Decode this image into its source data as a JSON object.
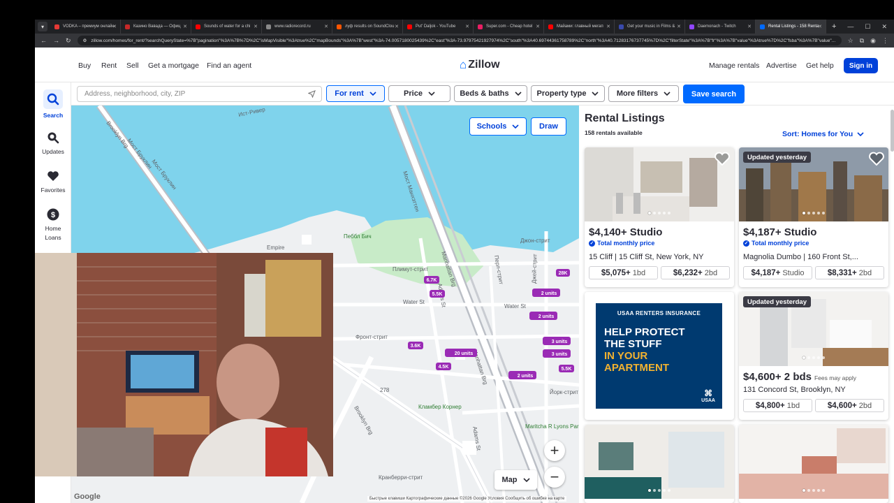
{
  "browser": {
    "tabs": [
      {
        "label": "VODKA – премиум онлайн",
        "color": "#e53935"
      },
      {
        "label": "Казино Вавада — Офиц",
        "color": "#c62828"
      },
      {
        "label": "Sounds of water for a chi",
        "color": "#ff0000"
      },
      {
        "label": "www.radiorecord.ru",
        "color": "#888888"
      },
      {
        "label": "луф results on SoundClou",
        "color": "#ff5500"
      },
      {
        "label": "Put' Daljok - YouTube",
        "color": "#ff0000"
      },
      {
        "label": "Super.com - Cheap hotel",
        "color": "#e91e63"
      },
      {
        "label": "Майами: главный мегап",
        "color": "#ff0000"
      },
      {
        "label": "Get your music in Films &",
        "color": "#3949ab"
      },
      {
        "label": "Daemonach - Twitch",
        "color": "#9146ff"
      },
      {
        "label": "Rental Listings - 158 Renta",
        "color": "#006aff"
      }
    ],
    "url": "zillow.com/homes/for_rent/?searchQueryState=%7B\"pagination\"%3A%7B%7D%2C\"isMapVisible\"%3Atrue%2C\"mapBounds\"%3A%7B\"west\"%3A-74.0057180025439%2C\"east\"%3A-73.97975421927974%2C\"south\"%3A40.69744361758789%2C\"north\"%3A40.71283176737745%7D%2C\"filterState\"%3A%7B\"fr\"%3A%7B\"value\"%3Atrue%7D%2C\"fsba\"%3A%7B\"value\"..."
  },
  "nav": {
    "left": [
      "Buy",
      "Rent",
      "Sell",
      "Get a mortgage",
      "Find an agent"
    ],
    "logo": "Zillow",
    "right": [
      "Manage rentals",
      "Advertise",
      "Get help"
    ],
    "signin": "Sign in"
  },
  "sidebar": {
    "search": "Search",
    "updates": "Updates",
    "favorites": "Favorites",
    "home": "Home",
    "loans": "Loans"
  },
  "search": {
    "placeholder": "Address, neighborhood, city, ZIP",
    "for_rent": "For rent",
    "price": "Price",
    "beds_baths": "Beds & baths",
    "property_type": "Property type",
    "more_filters": "More filters",
    "save": "Save search"
  },
  "map": {
    "schools": "Schools",
    "draw": "Draw",
    "map_type": "Map",
    "google": "Google",
    "attribution": "Быстрые клавиши   Картографические данные ©2026 Google   Условия   Сообщить об ошибке на карте",
    "labels": {
      "east_river": "Ист-Ривер",
      "brooklyn_br": "Brooklyn Brg",
      "most_brooklin": "Мост Бруклин",
      "most_manhattan": "Мост Манхэттен",
      "manhattan_brg": "Manhattan Brg",
      "manhattan_brg2": "Manhattan Brg",
      "pebble": "Пеббл Бич",
      "empire": "Empire",
      "plymouth": "Плимут-стрит",
      "water": "Water St",
      "water2": "Water St",
      "john": "Джон-стрит",
      "front": "Фронт-стрит",
      "adams": "Adams St",
      "adams2": "Adams St",
      "perl": "Перл-стрит",
      "jay": "Джей-стрит",
      "york": "Йорк-стрит",
      "clumber": "Кламбер Корнер",
      "maritcha": "Maritcha R Lyons Park",
      "cranberry": "Кранберри-стрит",
      "most_brooklin2": "Мост Бруклин",
      "brooklyn_br2": "Brooklyn Brg",
      "highway": "278"
    },
    "pins": [
      {
        "text": "6.7K",
        "new": true
      },
      {
        "text": "5.5K",
        "new": true
      },
      {
        "text": "28K",
        "new": false
      },
      {
        "text": "2 units",
        "new": false
      },
      {
        "text": "2 units",
        "new": false
      },
      {
        "text": "3 units",
        "new": true
      },
      {
        "text": "3 units",
        "new": false
      },
      {
        "text": "3.6K",
        "new": false
      },
      {
        "text": "20 units",
        "new": true
      },
      {
        "text": "4.5K",
        "new": false
      },
      {
        "text": "2 units",
        "new": false
      },
      {
        "text": "5.5K",
        "new": false
      }
    ]
  },
  "listings": {
    "title": "Rental Listings",
    "count": "158 rentals available",
    "sort": "Sort: Homes for You",
    "cards": [
      {
        "price": "$4,140+ Studio",
        "tag": "Total monthly price",
        "address": "15 Cliff | 15 Cliff St, New York, NY",
        "u1": "$5,075+",
        "u1bd": "1bd",
        "u2": "$6,232+",
        "u2bd": "2bd"
      },
      {
        "badge": "Updated yesterday",
        "price": "$4,187+ Studio",
        "tag": "Total monthly price",
        "address": "Magnolia Dumbo | 160 Front St,...",
        "u1": "$4,187+",
        "u1bd": "Studio",
        "u2": "$8,331+",
        "u2bd": "2bd"
      },
      {
        "badge": "Updated yesterday",
        "price": "$4,600+ 2 bds",
        "fees": "Fees may apply",
        "address": "131 Concord St, Brooklyn, NY",
        "u1": "$4,800+",
        "u1bd": "1bd",
        "u2": "$4,600+",
        "u2bd": "2bd"
      }
    ],
    "ad": {
      "top": "USAA RENTERS INSURANCE",
      "l1": "HELP PROTECT",
      "l2": "THE STUFF",
      "l3": "IN YOUR",
      "l4": "APARTMENT",
      "brand": "USAA"
    }
  },
  "colors": {
    "accent": "#006aff",
    "accent_dark": "#0041d9",
    "water": "#7fd3ec",
    "park": "#c8ebc8"
  }
}
